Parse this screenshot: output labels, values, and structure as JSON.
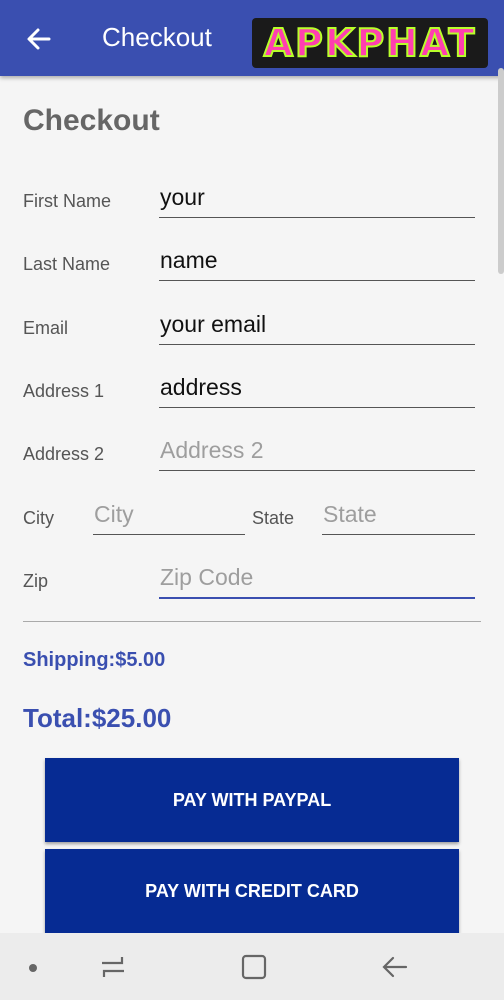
{
  "appbar": {
    "title": "Checkout",
    "back_icon": "arrow-left-icon"
  },
  "watermark": {
    "text": "APKPHAT"
  },
  "form": {
    "heading": "Checkout",
    "first_name": {
      "label": "First Name",
      "value": "your"
    },
    "last_name": {
      "label": "Last Name",
      "value": "name"
    },
    "email": {
      "label": "Email",
      "value": "your email"
    },
    "address1": {
      "label": "Address 1",
      "value": "address"
    },
    "address2": {
      "label": "Address 2",
      "placeholder": "Address 2"
    },
    "city": {
      "label": "City",
      "placeholder": "City"
    },
    "state": {
      "label": "State",
      "placeholder": "State"
    },
    "zip": {
      "label": "Zip",
      "placeholder": "Zip Code"
    }
  },
  "summary": {
    "shipping": "Shipping:$5.00",
    "total": "Total:$25.00"
  },
  "buttons": {
    "paypal": "PAY WITH PAYPAL",
    "credit_card": "PAY WITH CREDIT CARD"
  },
  "colors": {
    "primary": "#3a4fb0",
    "button": "#062b93"
  },
  "navbar": {
    "icons": [
      "dot-icon",
      "recents-icon",
      "home-icon",
      "back-icon"
    ]
  }
}
